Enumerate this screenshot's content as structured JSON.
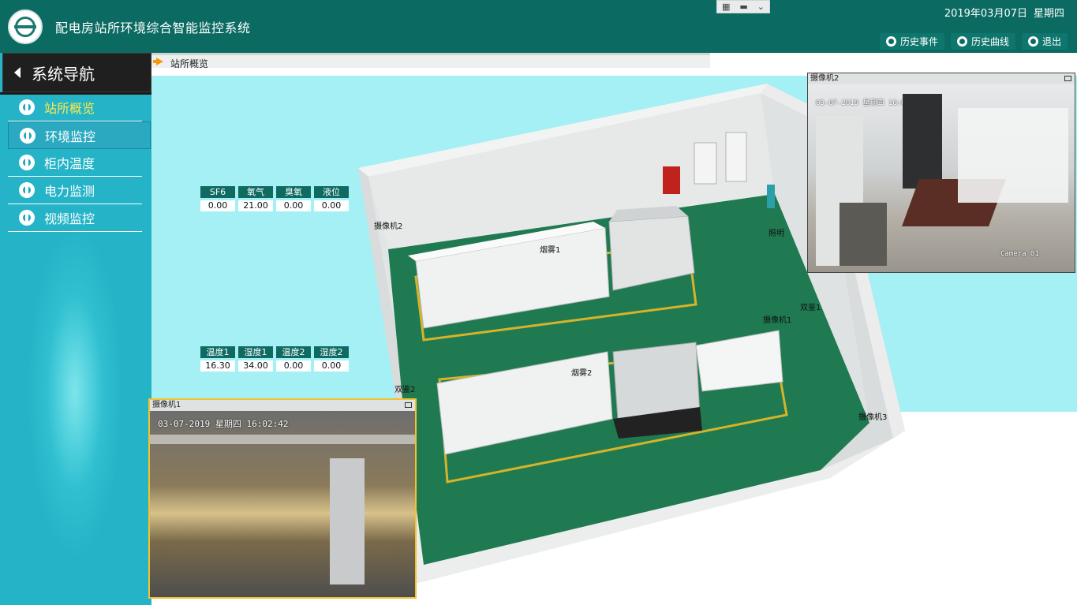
{
  "app": {
    "title": "配电房站所环境综合智能监控系统",
    "date": "2019年03月07日",
    "weekday": "星期四"
  },
  "topnav": [
    {
      "label": "历史事件",
      "icon": "ball-icon"
    },
    {
      "label": "历史曲线",
      "icon": "ball-icon"
    },
    {
      "label": "退出",
      "icon": "ball-icon"
    }
  ],
  "sidebar": {
    "title": "系统导航",
    "items": [
      {
        "label": "站所概览",
        "active": true
      },
      {
        "label": "环境监控",
        "active": false
      },
      {
        "label": "柜内温度",
        "active": false
      },
      {
        "label": "电力监测",
        "active": false
      },
      {
        "label": "视频监控",
        "active": false
      }
    ]
  },
  "breadcrumb": "站所概览",
  "sensors": {
    "gas": {
      "headers": [
        "SF6",
        "氧气",
        "臭氧",
        "液位"
      ],
      "values": [
        "0.00",
        "21.00",
        "0.00",
        "0.00"
      ]
    },
    "humidity": {
      "headers": [
        "温度1",
        "湿度1",
        "温度2",
        "湿度2"
      ],
      "values": [
        "16.30",
        "34.00",
        "0.00",
        "0.00"
      ]
    }
  },
  "scene_labels": {
    "camera2": "摄像机2",
    "smoke1": "烟雾1",
    "light": "照明",
    "camera1": "摄像机1",
    "dual1": "双鉴1",
    "smoke2": "烟雾2",
    "dual2": "双鉴2",
    "camera3": "摄像机3"
  },
  "cameras": {
    "cam1": {
      "title": "摄像机1",
      "osd_time": "03-07-2019 星期四 16:02:42"
    },
    "cam2": {
      "title": "摄像机2",
      "osd_time": "03-07-2019 星期四 16:02:41",
      "osd_name": "Camera 01"
    }
  },
  "colors": {
    "header": "#0b6a62",
    "sidebar": "#2fbfd0",
    "active_nav": "#ffe84a",
    "floor": "#1f7a52",
    "scene_bg": "#a5f0f4"
  }
}
